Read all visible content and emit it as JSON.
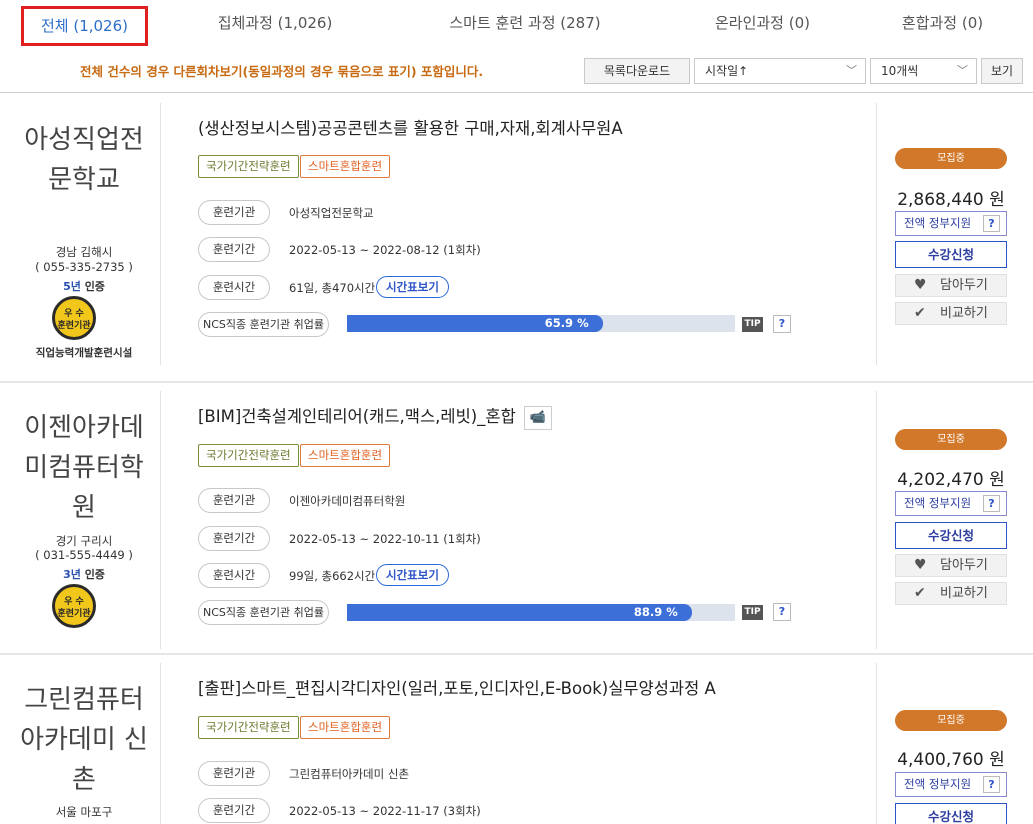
{
  "tabs": [
    {
      "label": "전체 (1,026)",
      "active": true
    },
    {
      "label": "집체과정 (1,026)"
    },
    {
      "label": "스마트 훈련 과정 (287)"
    },
    {
      "label": "온라인과정 (0)"
    },
    {
      "label": "혼합과정 (0)"
    }
  ],
  "toolbar": {
    "notice": "전체 건수의 경우 다른회차보기(동일과정의 경우 묶음으로 표기) 포함입니다.",
    "download_label": "목록다운로드",
    "sort_value": "시작일↑",
    "per_page_value": "10개씩",
    "view_label": "보기"
  },
  "labels": {
    "tag_national": "국가기간전략훈련",
    "tag_smart": "스마트혼합훈련",
    "institution": "훈련기관",
    "period": "훈련기간",
    "hours": "훈련시간",
    "employment": "NCS직종 훈련기관 취업률",
    "timetable": "시간표보기",
    "tip": "TIP",
    "question": "?",
    "status": "모집중",
    "gov_support": "전액 정부지원",
    "apply": "수강신청",
    "save": "담아두기",
    "compare": "비교하기",
    "cert_suffix": "인증",
    "badge_top": "우 수",
    "badge_bottom": "훈련기관",
    "facility": "직업능력개발훈련시설"
  },
  "courses": [
    {
      "org_line1": "아성직업전",
      "org_line2": "문학교",
      "region": "경남 김해시",
      "phone": "( 055-335-2735 )",
      "cert_years": "5년",
      "title": "(생산정보시스템)공공콘텐츠를 활용한 구매,자재,회계사무원A",
      "institution": "아성직업전문학교",
      "period": "2022-05-13 ~ 2022-08-12 (1회차)",
      "hours": "61일, 총470시간",
      "employment_rate": 65.9,
      "employment_text": "65.9 %",
      "price": "2,868,440 원"
    },
    {
      "org_line1": "이젠아카데",
      "org_line2": "미컴퓨터학",
      "org_line3": "원",
      "region": "경기 구리시",
      "phone": "( 031-555-4449 )",
      "cert_years": "3년",
      "title": "[BIM]건축설계인테리어(캐드,맥스,레빗)_혼합",
      "institution": "이젠아카데미컴퓨터학원",
      "period": "2022-05-13 ~ 2022-10-11 (1회차)",
      "hours": "99일, 총662시간",
      "employment_rate": 88.9,
      "employment_text": "88.9 %",
      "price": "4,202,470 원"
    },
    {
      "org_line1": "그린컴퓨터",
      "org_line2": "아카데미 신",
      "org_line3": "촌",
      "region": "서울 마포구",
      "title": "[출판]스마트_편집시각디자인(일러,포토,인디자인,E-Book)실무양성과정 A",
      "institution": "그린컴퓨터아카데미 신촌",
      "period": "2022-05-13 ~ 2022-11-17 (3회차)",
      "price": "4,400,760 원"
    }
  ]
}
